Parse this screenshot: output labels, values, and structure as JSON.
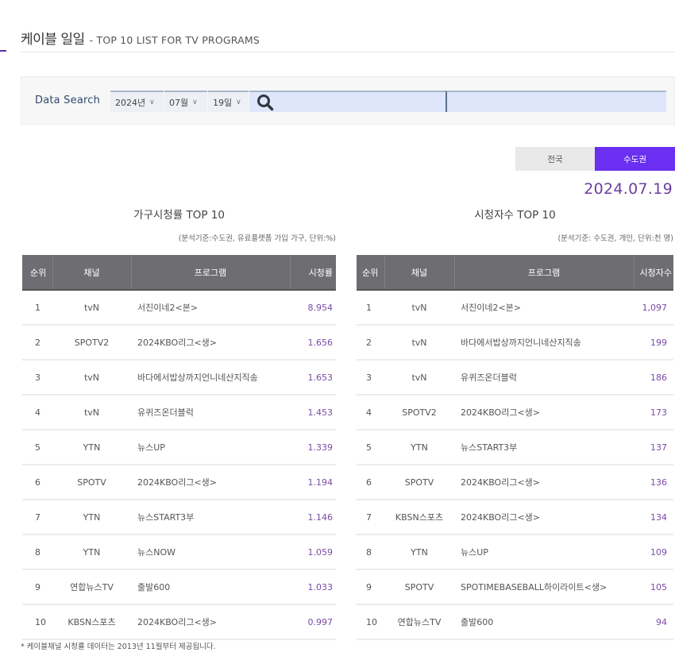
{
  "header": {
    "title_ko": "케이블 일일",
    "title_en": "- TOP 10 LIST FOR TV PROGRAMS"
  },
  "search": {
    "label": "Data Search",
    "year": "2024년",
    "month": "07월",
    "day": "19일",
    "icon": "search-icon"
  },
  "region_tabs": [
    {
      "label": "전국",
      "active": false
    },
    {
      "label": "수도권",
      "active": true
    }
  ],
  "date": "2024.07.19",
  "colors": {
    "accent": "#6a2ff0",
    "value_text": "#7a4aa6",
    "table_header": "#6e6e72"
  },
  "household_rating": {
    "title": "가구시청률 TOP 10",
    "note": "(분석기준:수도권, 유료플랫폼 가입 가구, 단위:%)",
    "columns": [
      "순위",
      "채널",
      "프로그램",
      "시청률"
    ],
    "rows": [
      {
        "rank": "1",
        "channel": "tvN",
        "program": "서진이네2<본>",
        "value": "8.954"
      },
      {
        "rank": "2",
        "channel": "SPOTV2",
        "program": "2024KBO리그<생>",
        "value": "1.656"
      },
      {
        "rank": "3",
        "channel": "tvN",
        "program": "바다에서밥상까지언니네산지직송",
        "value": "1.653"
      },
      {
        "rank": "4",
        "channel": "tvN",
        "program": "유퀴즈온더블럭",
        "value": "1.453"
      },
      {
        "rank": "5",
        "channel": "YTN",
        "program": "뉴스UP",
        "value": "1.339"
      },
      {
        "rank": "6",
        "channel": "SPOTV",
        "program": "2024KBO리그<생>",
        "value": "1.194"
      },
      {
        "rank": "7",
        "channel": "YTN",
        "program": "뉴스START3부",
        "value": "1.146"
      },
      {
        "rank": "8",
        "channel": "YTN",
        "program": "뉴스NOW",
        "value": "1.059"
      },
      {
        "rank": "9",
        "channel": "연합뉴스TV",
        "program": "출발600",
        "value": "1.033"
      },
      {
        "rank": "10",
        "channel": "KBSN스포츠",
        "program": "2024KBO리그<생>",
        "value": "0.997"
      }
    ]
  },
  "viewers": {
    "title": "시청자수 TOP 10",
    "note": "(분석기준: 수도권, 개인, 단위:천 명)",
    "columns": [
      "순위",
      "채널",
      "프로그램",
      "시청자수"
    ],
    "rows": [
      {
        "rank": "1",
        "channel": "tvN",
        "program": "서진이네2<본>",
        "value": "1,097"
      },
      {
        "rank": "2",
        "channel": "tvN",
        "program": "바다에서밥상까지언니네산지직송",
        "value": "199"
      },
      {
        "rank": "3",
        "channel": "tvN",
        "program": "유퀴즈온더블럭",
        "value": "186"
      },
      {
        "rank": "4",
        "channel": "SPOTV2",
        "program": "2024KBO리그<생>",
        "value": "173"
      },
      {
        "rank": "5",
        "channel": "YTN",
        "program": "뉴스START3부",
        "value": "137"
      },
      {
        "rank": "6",
        "channel": "SPOTV",
        "program": "2024KBO리그<생>",
        "value": "136"
      },
      {
        "rank": "7",
        "channel": "KBSN스포츠",
        "program": "2024KBO리그<생>",
        "value": "134"
      },
      {
        "rank": "8",
        "channel": "YTN",
        "program": "뉴스UP",
        "value": "109"
      },
      {
        "rank": "9",
        "channel": "SPOTV",
        "program": "SPOTIMEBASEBALL하이라이트<생>",
        "value": "105"
      },
      {
        "rank": "10",
        "channel": "연합뉴스TV",
        "program": "출발600",
        "value": "94"
      }
    ]
  },
  "footnote": "* 케이블채널 시청률 데이터는 2013년 11월부터 제공됩니다."
}
